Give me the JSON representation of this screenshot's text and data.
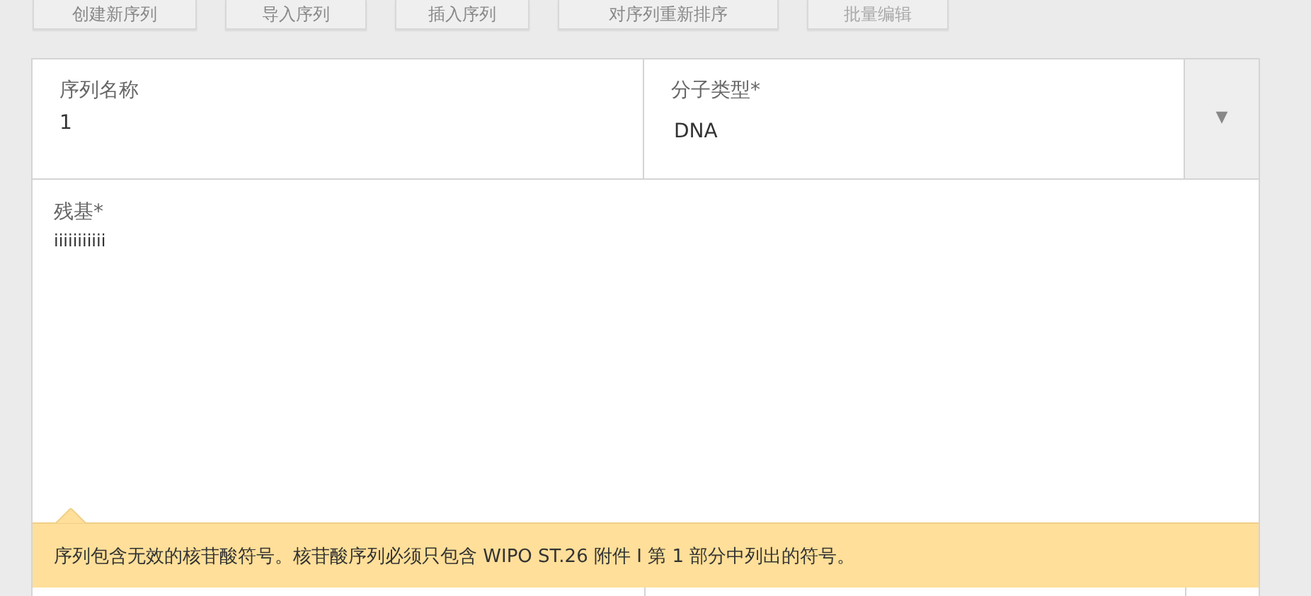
{
  "toolbar": [
    {
      "label": "创建新序列",
      "disabled": false
    },
    {
      "label": "导入序列",
      "disabled": false
    },
    {
      "label": "插入序列",
      "disabled": false
    },
    {
      "label": "对序列重新排序",
      "disabled": false
    },
    {
      "label": "批量编辑",
      "disabled": true
    }
  ],
  "sequence_name": {
    "label": "序列名称",
    "value": "1"
  },
  "molecule_type": {
    "label": "分子类型*",
    "value": "DNA",
    "dropdown_icon": "▼"
  },
  "residues": {
    "label": "残基*",
    "value": "iiiiiiiiiii"
  },
  "error_tooltip": {
    "text": "序列包含无效的核苷酸符号。核苷酸序列必须只包含 WIPO ST.26 附件 I 第 1 部分中列出的符号。"
  }
}
